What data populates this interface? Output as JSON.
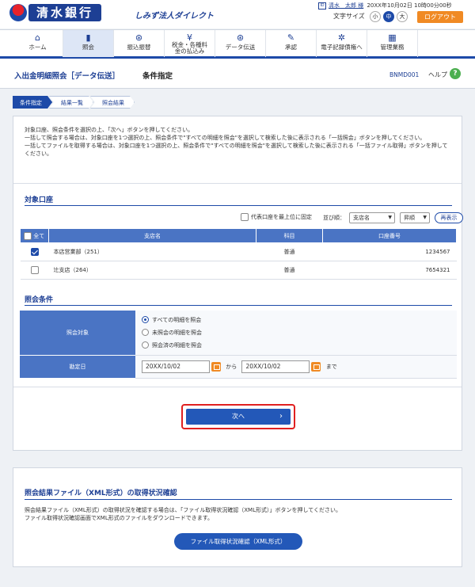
{
  "header": {
    "bank_name": "清水銀行",
    "bank_sub": "しみず法人ダイレクト",
    "user_name": "清水　太郎 様",
    "login_time": "20XX年10月02日 10時00分00秒",
    "font_size_label": "文字サイズ",
    "font_sizes": [
      "小",
      "中",
      "大"
    ],
    "logout_label": "ログアウト"
  },
  "nav": {
    "items": [
      {
        "label": "ホーム",
        "icon": "home-icon"
      },
      {
        "label": "照会",
        "icon": "document-icon"
      },
      {
        "label": "振込振替",
        "icon": "transfer-icon"
      },
      {
        "label": "税金・各種料金の払込み",
        "icon": "yen-icon"
      },
      {
        "label": "データ伝送",
        "icon": "data-transmission-icon"
      },
      {
        "label": "承認",
        "icon": "approval-icon"
      },
      {
        "label": "電子記録債権へ",
        "icon": "link-icon"
      },
      {
        "label": "管理業務",
        "icon": "admin-icon"
      }
    ],
    "active_index": 1
  },
  "title": {
    "main": "入出金明細照会［データ伝送］",
    "sub": "条件指定",
    "screen_id": "BNMD001",
    "help_label": "ヘルプ",
    "help_icon": "?"
  },
  "steps": [
    "条件指定",
    "結果一覧",
    "照会結果"
  ],
  "intro": {
    "line1": "対象口座、照会条件を選択の上、「次へ」ボタンを押してください。",
    "line2": "一括して照会する場合は、対象口座を1つ選択の上、照会条件で\"すべての明細を照会\"を選択して検索した後に表示される「一括照会」ボタンを押してください。",
    "line3": "一括してファイルを取得する場合は、対象口座を1つ選択の上、照会条件で\"すべての明細を照会\"を選択して検索した後に表示される「一括ファイル取得」ボタンを押してください。"
  },
  "accounts": {
    "section_title": "対象口座",
    "rep_first_label": "代表口座を最上位に固定",
    "order_label": "並び順：",
    "order_value": "支店名",
    "direction_value": "昇順",
    "redisplay_label": "再表示",
    "columns": {
      "all": "全て",
      "branch": "支店名",
      "subject": "科目",
      "number": "口座番号"
    },
    "rows": [
      {
        "branch": "本店営業部（251）",
        "subject": "普通",
        "number": "1234567",
        "checked": true
      },
      {
        "branch": "辻支店（264）",
        "subject": "普通",
        "number": "7654321",
        "checked": false
      }
    ]
  },
  "conditions": {
    "section_title": "照会条件",
    "target_label": "照会対象",
    "options": [
      "すべての明細を照会",
      "未照会の明細を照会",
      "照会済の明細を照会"
    ],
    "selected_option": 0,
    "date_label": "勘定日",
    "date_from": "20XX/10/02",
    "date_to": "20XX/10/02",
    "from_sep": "から",
    "to_sep": "まで"
  },
  "next_label": "次へ",
  "next_chevron": "›",
  "xml": {
    "title": "照会結果ファイル（XML形式）の取得状況確認",
    "text1": "照会結果ファイル（XML形式）の取得状況を確認する場合は、「ファイル取得状況確認（XML形式）」ボタンを押してください。",
    "text2": "ファイル取得状況確認画面でXML形式のファイルをダウンロードできます。",
    "button_label": "ファイル取得状況確認（XML形式）"
  },
  "colors": {
    "brand": "#1d3f94",
    "accent": "#f08a24",
    "highlight": "#e02020"
  }
}
